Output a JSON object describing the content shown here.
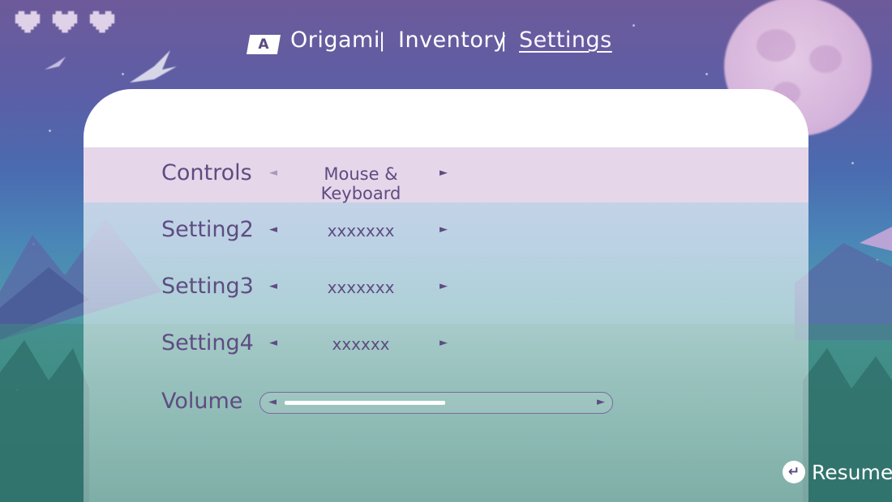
{
  "hud": {
    "hearts": 3
  },
  "nav": {
    "key_hint": "A",
    "tabs": [
      {
        "label": "Origami",
        "active": false
      },
      {
        "label": "Inventory",
        "active": false
      },
      {
        "label": "Settings",
        "active": true
      }
    ],
    "separator": "|"
  },
  "settings": {
    "rows": [
      {
        "label": "Controls",
        "value": "Mouse & Keyboard",
        "selected": true
      },
      {
        "label": "Setting2",
        "value": "xxxxxxx",
        "selected": false
      },
      {
        "label": "Setting3",
        "value": "xxxxxxx",
        "selected": false
      },
      {
        "label": "Setting4",
        "value": "xxxxxx",
        "selected": false
      }
    ],
    "volume": {
      "label": "Volume",
      "level": 0.48
    },
    "arrow_left": "◄",
    "arrow_right": "►"
  },
  "footer": {
    "resume_icon": "↵",
    "resume_label": "Resume"
  },
  "colors": {
    "text_primary": "#5e4c82",
    "selected_row": "#e6d6e9",
    "sky_top": "#6d5a9a",
    "ground": "#2f7a6e"
  }
}
